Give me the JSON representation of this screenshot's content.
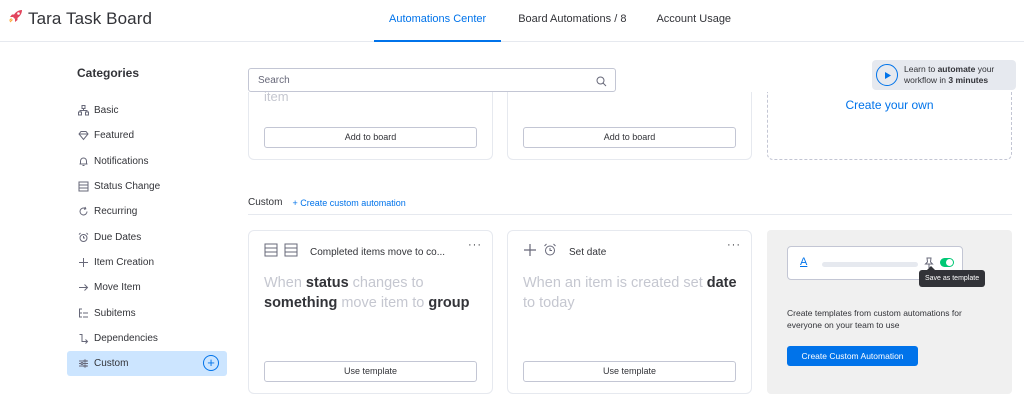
{
  "app": {
    "title": "Tara Task Board"
  },
  "tabs": [
    {
      "label": "Automations Center",
      "active": true
    },
    {
      "label": "Board Automations / 8",
      "active": false
    },
    {
      "label": "Account Usage",
      "active": false
    }
  ],
  "sidebar": {
    "title": "Categories",
    "items": [
      {
        "label": "Basic",
        "icon": "hierarchy-icon"
      },
      {
        "label": "Featured",
        "icon": "diamond-icon"
      },
      {
        "label": "Notifications",
        "icon": "bell-icon"
      },
      {
        "label": "Status Change",
        "icon": "status-list-icon"
      },
      {
        "label": "Recurring",
        "icon": "recurring-icon"
      },
      {
        "label": "Due Dates",
        "icon": "alarm-icon"
      },
      {
        "label": "Item Creation",
        "icon": "plus-icon"
      },
      {
        "label": "Move Item",
        "icon": "arrow-right-icon"
      },
      {
        "label": "Subitems",
        "icon": "subitems-icon"
      },
      {
        "label": "Dependencies",
        "icon": "dependency-icon"
      },
      {
        "label": "Custom",
        "icon": "sliders-icon",
        "active": true
      }
    ]
  },
  "search": {
    "placeholder": "Search",
    "value": ""
  },
  "learn": {
    "prefix": "Learn to ",
    "bold1": "automate",
    "mid": " your workflow in ",
    "bold2": "3 minutes"
  },
  "top_cards": [
    {
      "cutoff_text": "item",
      "button": "Add to board"
    },
    {
      "cutoff_text": "",
      "button": "Add to board"
    }
  ],
  "create_own": {
    "label": "Create your own"
  },
  "custom_section": {
    "title": "Custom",
    "link": "+ Create custom automation"
  },
  "custom_cards": [
    {
      "title": "Completed items move to co...",
      "recipe": {
        "p1": "When ",
        "b1": "status",
        "p2": " changes to ",
        "b2": "something",
        "p3": " move item to ",
        "b3": "group"
      },
      "button": "Use template"
    },
    {
      "title": "Set date",
      "recipe": {
        "p1": "When an item is created set ",
        "b1": "date",
        "p2": " to today"
      },
      "button": "Use template"
    }
  ],
  "promo": {
    "mock_letter": "A",
    "tooltip": "Save as template",
    "text": "Create templates from custom automations for everyone on your team to use",
    "button": "Create Custom Automation"
  },
  "colors": {
    "accent": "#0073ea",
    "active_bg": "#cce5ff",
    "toggle_on": "#00c875",
    "muted_text": "#c5c7d0"
  }
}
